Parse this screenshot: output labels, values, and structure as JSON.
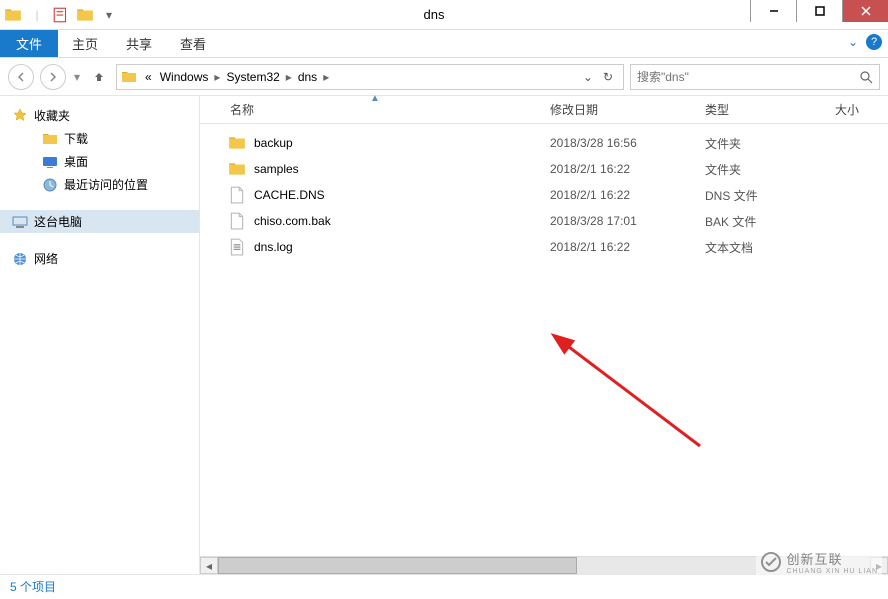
{
  "window": {
    "title": "dns"
  },
  "ribbon": {
    "file": "文件",
    "tabs": [
      "主页",
      "共享",
      "查看"
    ]
  },
  "breadcrumb": {
    "prefix": "«",
    "parts": [
      "Windows",
      "System32",
      "dns"
    ]
  },
  "search": {
    "placeholder": "搜索\"dns\""
  },
  "sidebar": {
    "favorites": {
      "label": "收藏夹",
      "items": [
        "下载",
        "桌面",
        "最近访问的位置"
      ]
    },
    "computer": {
      "label": "这台电脑"
    },
    "network": {
      "label": "网络"
    }
  },
  "columns": {
    "name": "名称",
    "date": "修改日期",
    "type": "类型",
    "size": "大小"
  },
  "files": [
    {
      "icon": "folder",
      "name": "backup",
      "date": "2018/3/28 16:56",
      "type": "文件夹"
    },
    {
      "icon": "folder",
      "name": "samples",
      "date": "2018/2/1 16:22",
      "type": "文件夹"
    },
    {
      "icon": "file",
      "name": "CACHE.DNS",
      "date": "2018/2/1 16:22",
      "type": "DNS 文件"
    },
    {
      "icon": "file",
      "name": "chiso.com.bak",
      "date": "2018/3/28 17:01",
      "type": "BAK 文件"
    },
    {
      "icon": "text",
      "name": "dns.log",
      "date": "2018/2/1 16:22",
      "type": "文本文档"
    }
  ],
  "status": {
    "count": "5 个项目"
  },
  "watermark": {
    "main": "创新互联",
    "sub": "CHUANG XIN HU LIAN"
  }
}
